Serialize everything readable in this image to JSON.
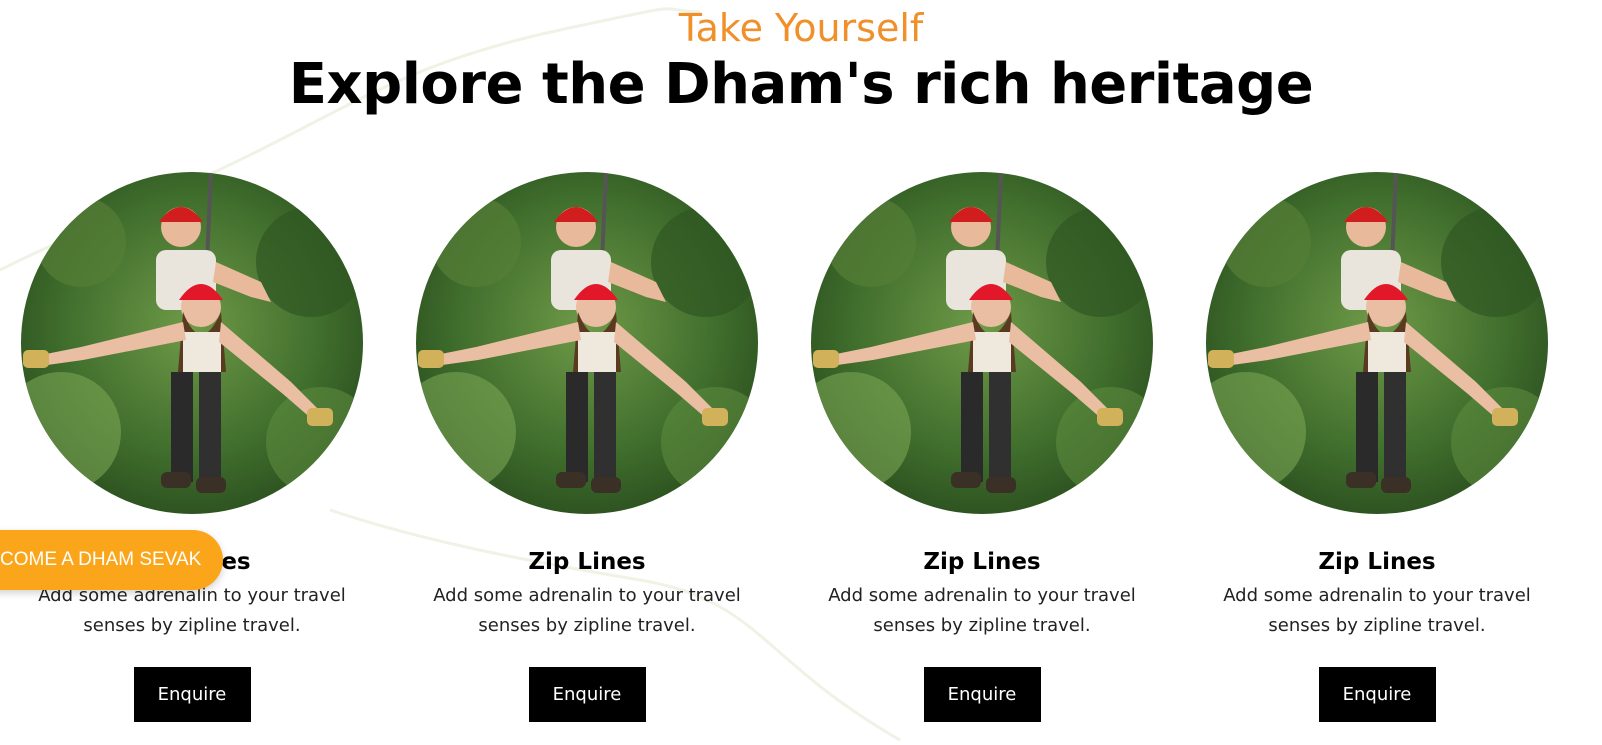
{
  "section": {
    "eyebrow": "Take Yourself",
    "title": "Explore the Dham's rich heritage"
  },
  "cards": [
    {
      "name": "Zip Lines",
      "desc": "Add some adrenalin to your travel senses by zipline travel.",
      "button": "Enquire"
    },
    {
      "name": "Zip Lines",
      "desc": "Add some adrenalin to your travel senses by zipline travel.",
      "button": "Enquire"
    },
    {
      "name": "Zip Lines",
      "desc": "Add some adrenalin to your travel senses by zipline travel.",
      "button": "Enquire"
    },
    {
      "name": "Zip Lines",
      "desc": "Add some adrenalin to your travel senses by zipline travel.",
      "button": "Enquire"
    }
  ],
  "floating_cta": {
    "label": "COME A DHAM SEVAK"
  },
  "colors": {
    "accent": "#f0902a",
    "cta": "#fba61a",
    "button": "#000000"
  }
}
